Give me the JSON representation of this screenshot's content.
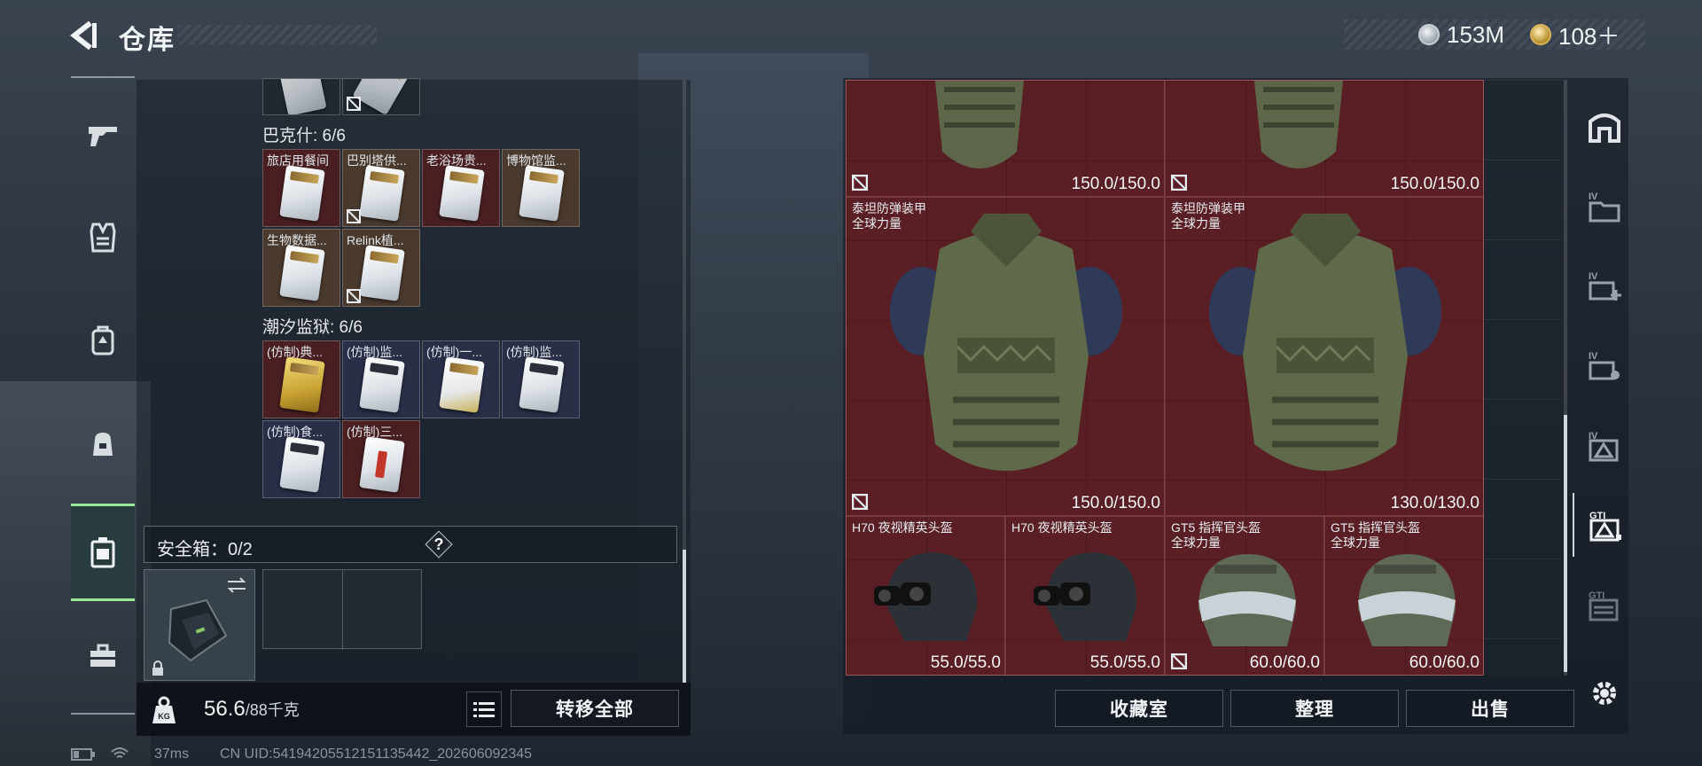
{
  "header": {
    "title": "仓库",
    "currency": [
      {
        "icon": "silver-coin-icon",
        "value": "153M"
      },
      {
        "icon": "gold-coin-icon",
        "value": "108＋"
      }
    ]
  },
  "left_nav": [
    "weapon",
    "armor-vest",
    "backpack-gear",
    "bag",
    "safe-box",
    "toolbox"
  ],
  "stash": {
    "groups": [
      {
        "title": "巴克什: 6/6",
        "items": [
          {
            "name": "旅店用餐间",
            "color": "red",
            "no_sell": false
          },
          {
            "name": "巴别塔供...",
            "color": "brown",
            "no_sell": true
          },
          {
            "name": "老浴场贵...",
            "color": "red",
            "no_sell": false
          },
          {
            "name": "博物馆监...",
            "color": "brown",
            "no_sell": false
          },
          {
            "name": "生物数据...",
            "color": "brown",
            "no_sell": false
          },
          {
            "name": "Relink植...",
            "color": "brown",
            "no_sell": true
          }
        ]
      },
      {
        "title": "潮汐监狱: 6/6",
        "items": [
          {
            "name": "(仿制)典...",
            "color": "red",
            "card": "gold"
          },
          {
            "name": "(仿制)监...",
            "color": "navy",
            "card": "dark"
          },
          {
            "name": "(仿制)一...",
            "color": "navy",
            "card": "gold"
          },
          {
            "name": "(仿制)监...",
            "color": "navy",
            "card": "dark"
          },
          {
            "name": "(仿制)食...",
            "color": "navy",
            "card": "dark"
          },
          {
            "name": "(仿制)三...",
            "color": "red",
            "card": "redstripe"
          }
        ]
      }
    ],
    "safe_box": {
      "label": "安全箱：0/2",
      "help": "?"
    },
    "weight": {
      "current": "56.6",
      "max": "/88千克"
    },
    "transfer_all": "转移全部"
  },
  "container": {
    "items": [
      {
        "name": "",
        "durability": "150.0/150.0",
        "no_sell": true
      },
      {
        "name": "",
        "durability": "150.0/150.0",
        "no_sell": true
      },
      {
        "name": "泰坦防弹装甲\n全球力量",
        "durability": "150.0/150.0",
        "no_sell": true
      },
      {
        "name": "泰坦防弹装甲\n全球力量",
        "durability": "130.0/130.0",
        "no_sell": false
      },
      {
        "name": "H70 夜视精英头盔",
        "durability": "55.0/55.0",
        "no_sell": false
      },
      {
        "name": "H70 夜视精英头盔",
        "durability": "55.0/55.0",
        "no_sell": false
      },
      {
        "name": "GT5 指挥官头盔\n全球力量",
        "durability": "60.0/60.0",
        "no_sell": true
      },
      {
        "name": "GT5 指挥官头盔\n全球力量",
        "durability": "60.0/60.0",
        "no_sell": false
      }
    ],
    "buttons": {
      "collection": "收藏室",
      "sort": "整理",
      "sell": "出售"
    }
  },
  "right_nav": [
    "storage-home",
    "IV",
    "IV",
    "IV",
    "IV",
    "GTI",
    "GTI",
    "settings"
  ],
  "status_bar": {
    "ping": "37ms",
    "uid": "CN UID:54194205512151135442_202606092345"
  },
  "colors": {
    "accent_green": "#9ce89a",
    "container_red": "#5a1f25"
  }
}
